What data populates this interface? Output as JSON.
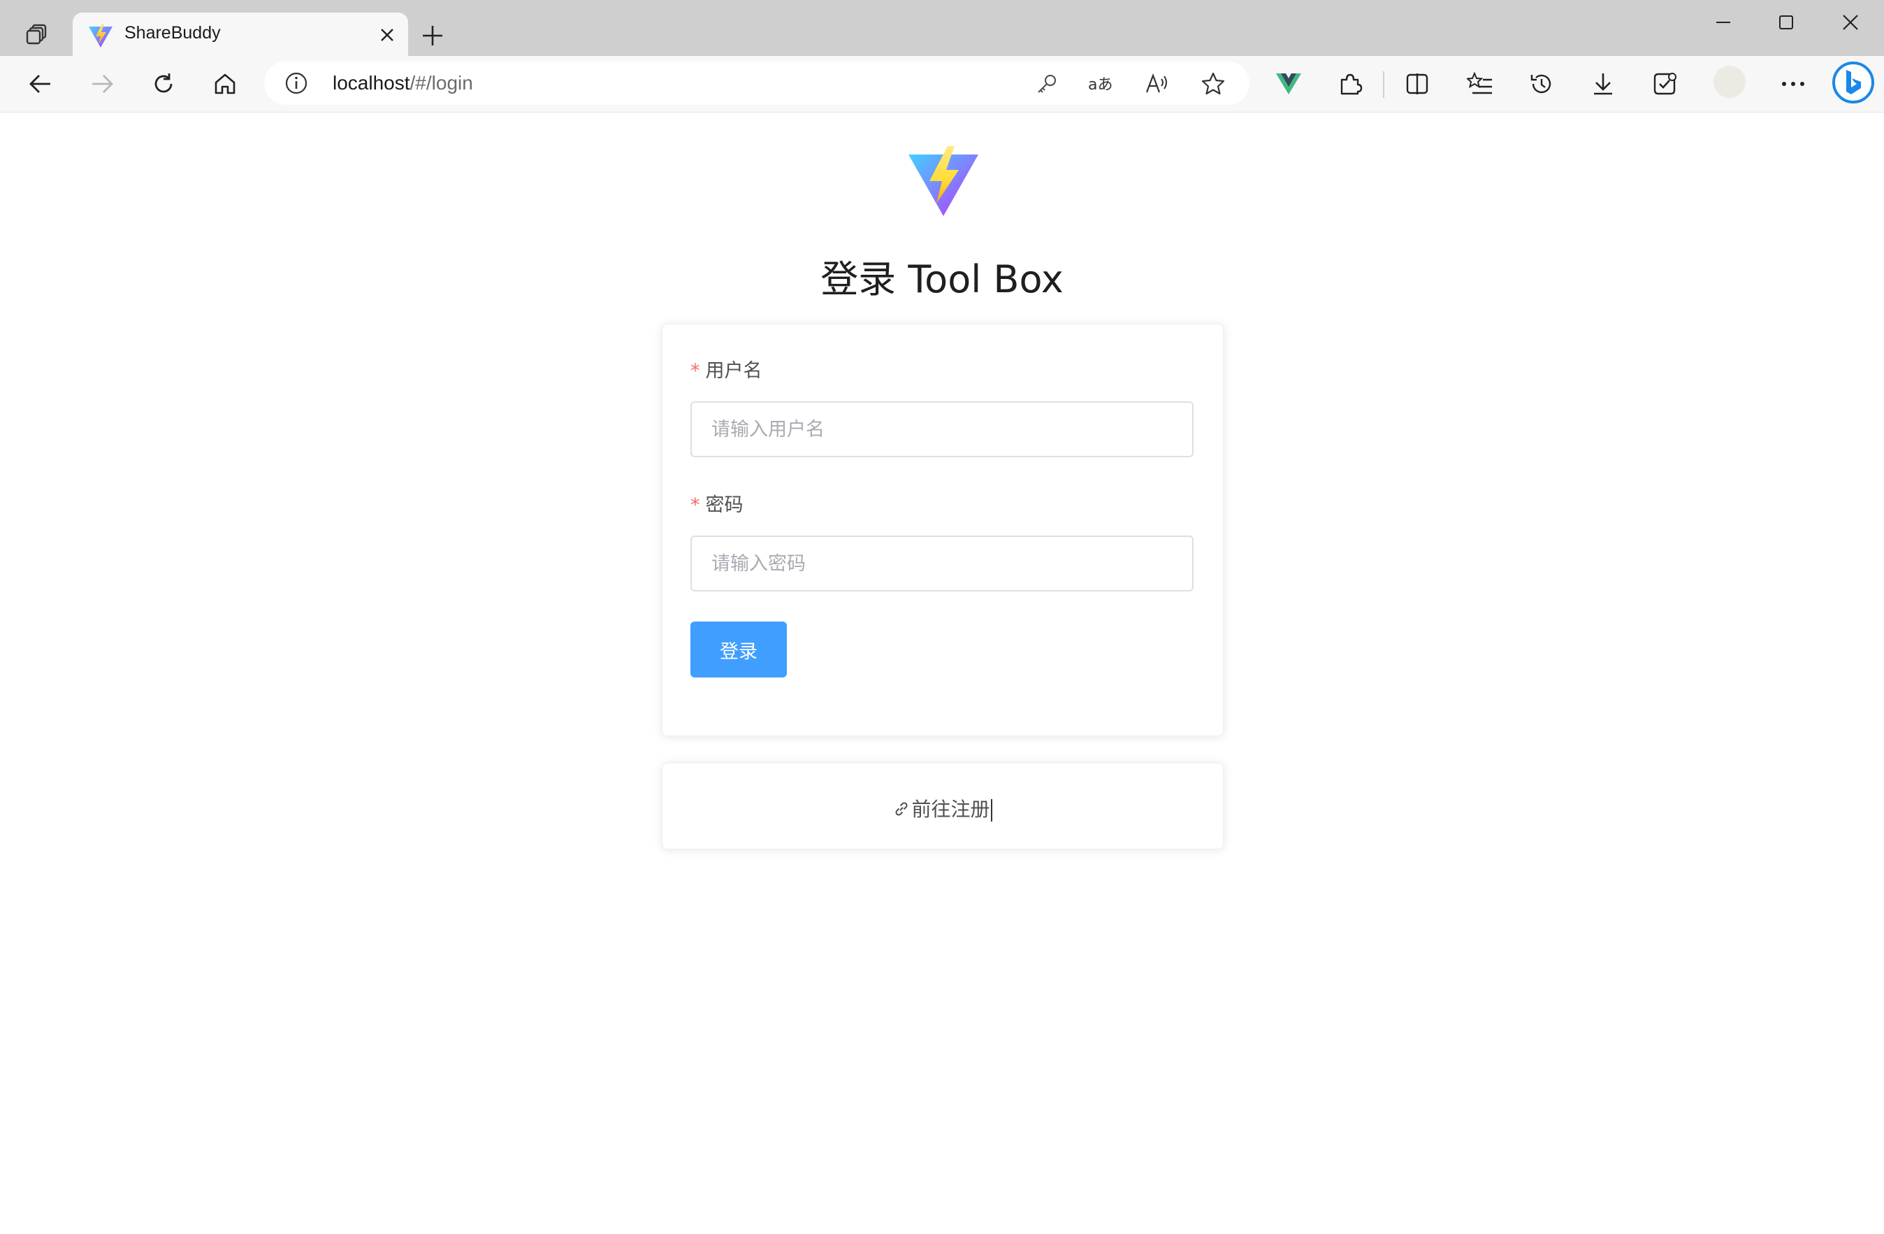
{
  "browser": {
    "tab": {
      "title": "ShareBuddy"
    },
    "address": {
      "host": "localhost",
      "path": "/#/login"
    }
  },
  "page": {
    "heading": "登录 Tool Box",
    "form": {
      "username": {
        "label": "用户名",
        "placeholder": "请输入用户名",
        "required": "*"
      },
      "password": {
        "label": "密码",
        "placeholder": "请输入密码",
        "required": "*"
      },
      "submit_label": "登录"
    },
    "register_link": "前往注册"
  },
  "colors": {
    "primary": "#409eff",
    "required": "#f56c6c"
  }
}
